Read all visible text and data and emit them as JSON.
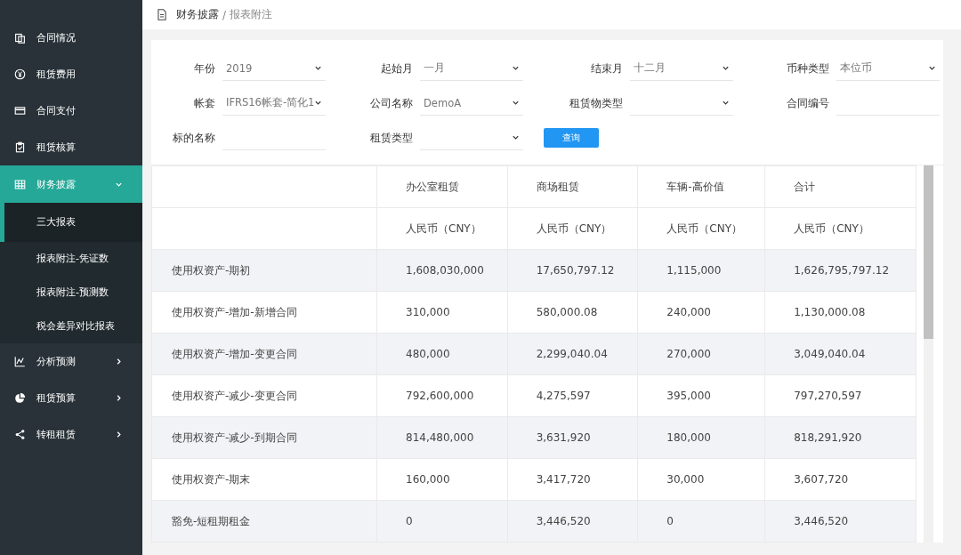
{
  "sidebar": {
    "items": [
      {
        "label": "合同情况",
        "selected": false
      },
      {
        "label": "租赁费用",
        "selected": false
      },
      {
        "label": "合同支付",
        "selected": false
      },
      {
        "label": "租赁核算",
        "selected": false
      },
      {
        "label": "财务披露",
        "selected": true,
        "expanded": true,
        "children": [
          {
            "label": "三大报表",
            "selected": true
          },
          {
            "label": "报表附注-凭证数",
            "selected": false
          },
          {
            "label": "报表附注-预测数",
            "selected": false
          },
          {
            "label": "税会差异对比报表",
            "selected": false
          }
        ]
      },
      {
        "label": "分析预测",
        "selected": false,
        "expanded": false
      },
      {
        "label": "租赁预算",
        "selected": false,
        "expanded": false
      },
      {
        "label": "转租租赁",
        "selected": false,
        "expanded": false
      }
    ]
  },
  "breadcrumb": {
    "parent": "财务披露",
    "separator": "/",
    "current": "报表附注"
  },
  "filters": [
    {
      "label": "年份",
      "value": "2019",
      "kind": "select"
    },
    {
      "label": "起始月",
      "value": "一月",
      "kind": "select"
    },
    {
      "label": "结束月",
      "value": "十二月",
      "kind": "select"
    },
    {
      "label": "币种类型",
      "value": "本位币",
      "kind": "select"
    },
    {
      "label": "帐套",
      "value": "IFRS16帐套-简化1",
      "kind": "select"
    },
    {
      "label": "公司名称",
      "value": "DemoA",
      "kind": "select"
    },
    {
      "label": "租赁物类型",
      "kind": "select"
    },
    {
      "label": "合同编号",
      "kind": "text"
    },
    {
      "label": "标的名称",
      "kind": "text"
    },
    {
      "label": "租赁类型",
      "kind": "select"
    }
  ],
  "search_button": "查询",
  "table": {
    "columns": [
      "办公室租赁",
      "商场租赁",
      "车辆-高价值",
      "合计"
    ],
    "currencies": [
      "人民币（CNY）",
      "人民币（CNY）",
      "人民币（CNY）",
      "人民币（CNY）"
    ],
    "rows": [
      {
        "label": "使用权资产-期初",
        "values": [
          "1,608,030,000",
          "17,650,797.12",
          "1,115,000",
          "1,626,795,797.12"
        ]
      },
      {
        "label": "使用权资产-增加-新增合同",
        "values": [
          "310,000",
          "580,000.08",
          "240,000",
          "1,130,000.08"
        ]
      },
      {
        "label": "使用权资产-增加-变更合同",
        "values": [
          "480,000",
          "2,299,040.04",
          "270,000",
          "3,049,040.04"
        ]
      },
      {
        "label": "使用权资产-减少-变更合同",
        "values": [
          "792,600,000",
          "4,275,597",
          "395,000",
          "797,270,597"
        ]
      },
      {
        "label": "使用权资产-减少-到期合同",
        "values": [
          "814,480,000",
          "3,631,920",
          "180,000",
          "818,291,920"
        ]
      },
      {
        "label": "使用权资产-期末",
        "values": [
          "160,000",
          "3,417,720",
          "30,000",
          "3,607,720"
        ]
      },
      {
        "label": "豁免-短租期租金",
        "values": [
          "0",
          "3,446,520",
          "0",
          "3,446,520"
        ]
      }
    ]
  }
}
